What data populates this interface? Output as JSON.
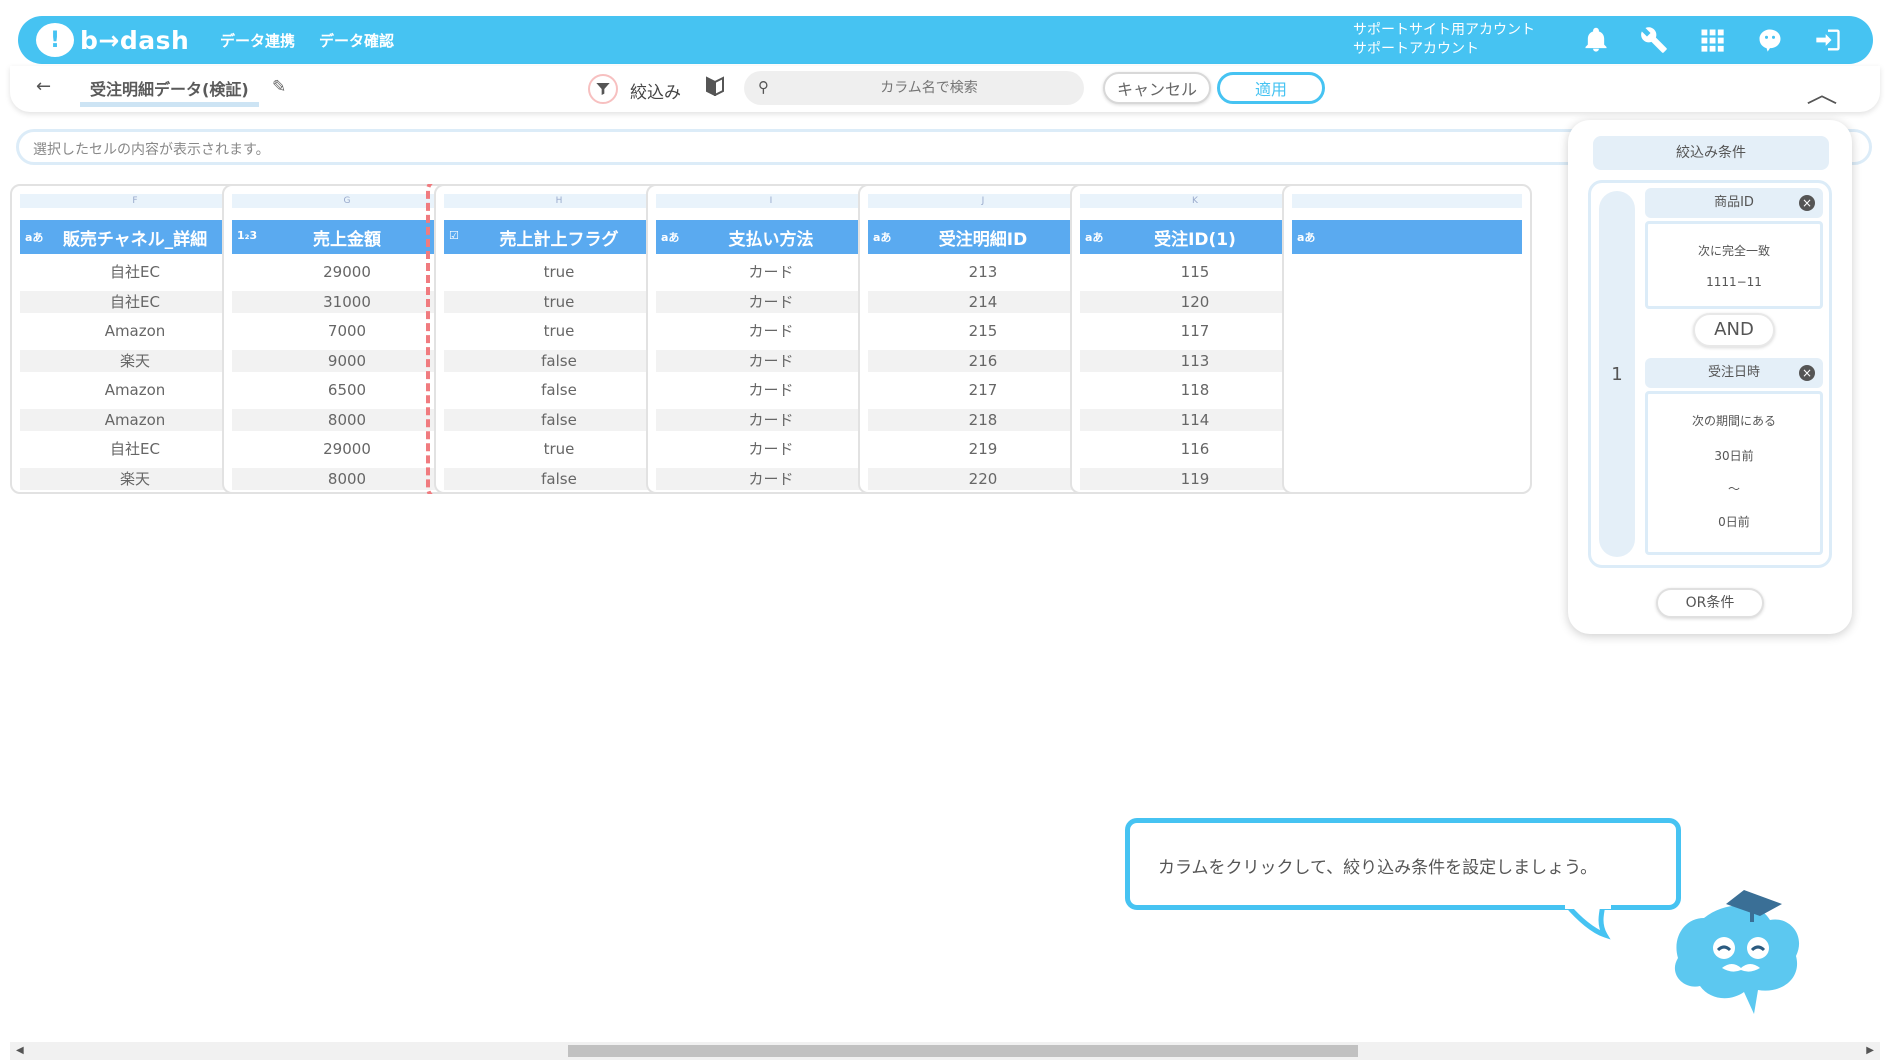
{
  "app": {
    "logo_text": "b→dash",
    "logo_mark": "!"
  },
  "nav": {
    "items": [
      "データ連携",
      "データ確認"
    ]
  },
  "account": {
    "line1": "サポートサイト用アカウント",
    "line2": "サポートアカウント"
  },
  "top_icons": [
    "bell-icon",
    "wrench-icon",
    "grid-icon",
    "mascot-face-icon",
    "logout-icon"
  ],
  "subheader": {
    "back": "←",
    "title": "受注明細データ(検証)",
    "filter_label": "絞込み",
    "search_placeholder": "カラム名で検索",
    "cancel_label": "キャンセル",
    "apply_label": "適用"
  },
  "cellbar": {
    "placeholder": "選択したセルの内容が表示されます。"
  },
  "columns": [
    {
      "letter": "F",
      "type": "aあ",
      "name": "販売チャネル_詳細",
      "values": [
        "自社EC",
        "自社EC",
        "Amazon",
        "楽天",
        "Amazon",
        "Amazon",
        "自社EC",
        "楽天"
      ]
    },
    {
      "letter": "G",
      "type": "1₂3",
      "name": "売上金額",
      "values": [
        "29000",
        "31000",
        "7000",
        "9000",
        "6500",
        "8000",
        "29000",
        "8000"
      ]
    },
    {
      "letter": "H",
      "type": "☑",
      "name": "売上計上フラグ",
      "values": [
        "true",
        "true",
        "true",
        "false",
        "false",
        "false",
        "true",
        "false"
      ]
    },
    {
      "letter": "I",
      "type": "aあ",
      "name": "支払い方法",
      "values": [
        "カード",
        "カード",
        "カード",
        "カード",
        "カード",
        "カード",
        "カード",
        "カード"
      ]
    },
    {
      "letter": "J",
      "type": "aあ",
      "name": "受注明細ID",
      "values": [
        "213",
        "214",
        "215",
        "216",
        "217",
        "218",
        "219",
        "220"
      ]
    },
    {
      "letter": "K",
      "type": "aあ",
      "name": "受注ID(1)",
      "values": [
        "115",
        "120",
        "117",
        "113",
        "118",
        "114",
        "116",
        "119"
      ]
    }
  ],
  "partial_column": {
    "type": "aあ"
  },
  "filter_panel": {
    "title": "絞込み条件",
    "group_number": "1",
    "cond1": {
      "field": "商品ID",
      "operator": "次に完全一致",
      "value": "1111−11"
    },
    "and_label": "AND",
    "cond2": {
      "field": "受注日時",
      "operator": "次の期間にある",
      "from": "30日前",
      "sep": "〜",
      "to": "0日前"
    },
    "or_label": "OR条件"
  },
  "tooltip": {
    "text": "カラムをクリックして、絞り込み条件を設定しましょう。"
  },
  "colors": {
    "brand": "#46c3f2",
    "header_blue": "#5aaaf0",
    "highlight": "#f07b7f"
  }
}
